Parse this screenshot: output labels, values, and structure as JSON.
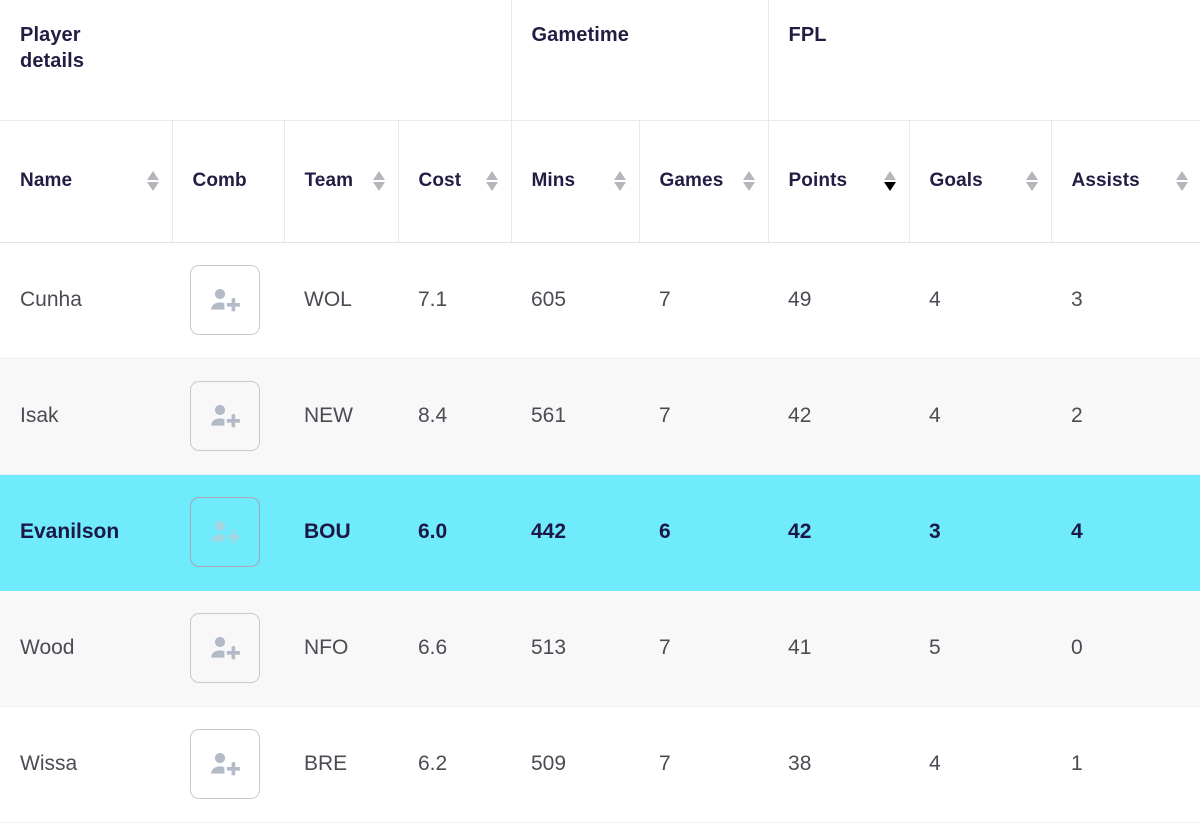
{
  "table": {
    "group_headers": [
      {
        "label": "Player details",
        "span": 4
      },
      {
        "label": "Gametime",
        "span": 2
      },
      {
        "label": "FPL",
        "span": 3
      }
    ],
    "columns": [
      {
        "key": "name",
        "label": "Name",
        "sortable": true,
        "sort": "none"
      },
      {
        "key": "comb",
        "label": "Comb",
        "sortable": false,
        "sort": "none"
      },
      {
        "key": "team",
        "label": "Team",
        "sortable": true,
        "sort": "none"
      },
      {
        "key": "cost",
        "label": "Cost",
        "sortable": true,
        "sort": "none"
      },
      {
        "key": "mins",
        "label": "Mins",
        "sortable": true,
        "sort": "none"
      },
      {
        "key": "games",
        "label": "Games",
        "sortable": true,
        "sort": "none"
      },
      {
        "key": "points",
        "label": "Points",
        "sortable": true,
        "sort": "desc"
      },
      {
        "key": "goals",
        "label": "Goals",
        "sortable": true,
        "sort": "none"
      },
      {
        "key": "assists",
        "label": "Assists",
        "sortable": true,
        "sort": "none"
      }
    ],
    "add_button_icon": "add-person-icon",
    "rows": [
      {
        "name": "Cunha",
        "team": "WOL",
        "cost": "7.1",
        "mins": "605",
        "games": "7",
        "points": "49",
        "goals": "4",
        "assists": "3",
        "selected": false
      },
      {
        "name": "Isak",
        "team": "NEW",
        "cost": "8.4",
        "mins": "561",
        "games": "7",
        "points": "42",
        "goals": "4",
        "assists": "2",
        "selected": false
      },
      {
        "name": "Evanilson",
        "team": "BOU",
        "cost": "6.0",
        "mins": "442",
        "games": "6",
        "points": "42",
        "goals": "3",
        "assists": "4",
        "selected": true
      },
      {
        "name": "Wood",
        "team": "NFO",
        "cost": "6.6",
        "mins": "513",
        "games": "7",
        "points": "41",
        "goals": "5",
        "assists": "0",
        "selected": false
      },
      {
        "name": "Wissa",
        "team": "BRE",
        "cost": "6.2",
        "mins": "509",
        "games": "7",
        "points": "38",
        "goals": "4",
        "assists": "1",
        "selected": false
      }
    ]
  },
  "colors": {
    "selected_row": "#6febfb",
    "header_text": "#231d44",
    "body_text": "#4b4b54",
    "stripe": "#f8f8f9",
    "border": "#e9e9ec",
    "sort_inactive": "#b5b5bb",
    "sort_active": "#000000"
  }
}
